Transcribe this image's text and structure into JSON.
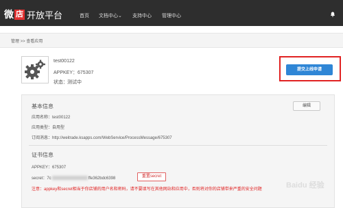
{
  "brand": {
    "part1": "微",
    "part2": "店",
    "part3": "开放平台"
  },
  "nav": [
    {
      "label": "首页"
    },
    {
      "label": "文档中心⌄"
    },
    {
      "label": "支持中心"
    },
    {
      "label": "管理中心"
    }
  ],
  "icons": {
    "bell": "bell-icon",
    "app_logo": "gears-icon"
  },
  "breadcrumb": "管理 >> 查看应用",
  "app": {
    "name": "test00122",
    "appkey": "APPKEY：675307",
    "status_label": "状态：",
    "status_value": "测试中"
  },
  "submit_button": "提交上线申请",
  "basic": {
    "title": "基本信息",
    "edit_button": "编辑",
    "name_row": "应用名称：test00122",
    "type_row": "应用类型：自用型",
    "url_row": "订阅消息：http://weitrade.ksapps.com/WebService/ProcessMessage/675307"
  },
  "cert": {
    "title": "证书信息",
    "appkey_row": "APPKEY：675307",
    "secret_prefix": "secret：7c",
    "secret_suffix": "ffe362bdc6398",
    "reset_button": "重置secret"
  },
  "notice": "注意：appkey和secret相当于你店铺的用户名和密码，请不要填写在其他网站和应用中，否则将对你的店铺带来严重的安全问题",
  "watermark": "Baidu 经验",
  "colors": {
    "topbar": "#2e2e2e",
    "accent_red": "#e23131",
    "button_blue": "#2f86d6",
    "warn": "#e02020"
  }
}
